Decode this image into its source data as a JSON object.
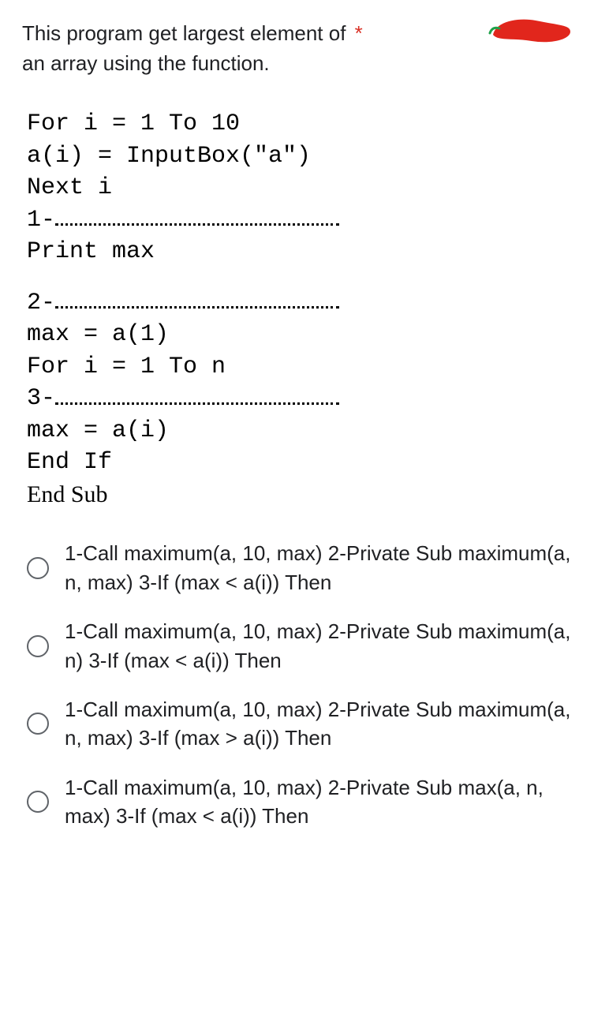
{
  "question": {
    "line1": "This program get largest element of",
    "line2": "an array using the function.",
    "asterisk": "*"
  },
  "code": {
    "l1": "For i = 1 To 10",
    "l2": "a(i) = InputBox(\"a\")",
    "l3": "Next i",
    "b1": "1-",
    "l4": "Print max",
    "b2": "2-",
    "l5": "max = a(1)",
    "l6": "For i = 1 To n",
    "b3": "3-",
    "l7": "max = a(i)",
    "l8": "End If",
    "l9": "End Sub"
  },
  "options": [
    "1-Call maximum(a, 10, max) 2-Private Sub maximum(a, n, max) 3-If (max < a(i)) Then",
    "1-Call maximum(a, 10, max) 2-Private Sub maximum(a, n) 3-If (max < a(i)) Then",
    "1-Call maximum(a, 10, max) 2-Private Sub maximum(a, n, max) 3-If (max > a(i)) Then",
    "1-Call maximum(a, 10, max) 2-Private Sub max(a, n, max) 3-If (max < a(i)) Then"
  ]
}
